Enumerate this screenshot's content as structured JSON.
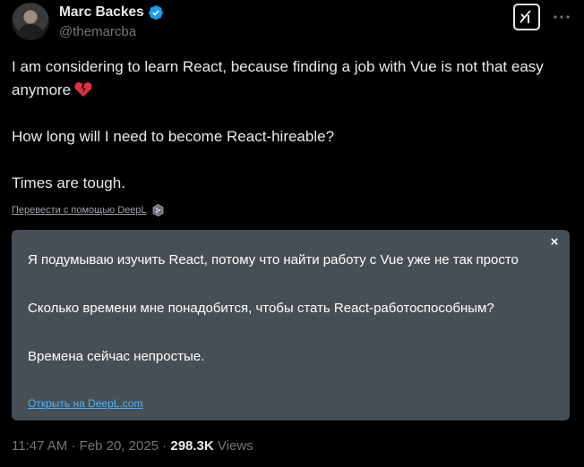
{
  "author": {
    "display_name": "Marc Backes",
    "handle": "@themarcba",
    "verified": true
  },
  "icons": {
    "verified": "verified-badge-icon",
    "grok": "grok-icon",
    "more": "more-options-icon",
    "broken_heart": "broken-heart-emoji",
    "deepl": "deepl-logo-icon",
    "close": "close-icon"
  },
  "tweet": {
    "line1": "I am considering to learn React, because finding a job with Vue is not that easy anymore",
    "line2": "How long will I need to become React-hireable?",
    "line3": "Times are tough."
  },
  "translate_link": "Перевести с помощью DeepL",
  "translation": {
    "line1": "Я подумываю изучить React, потому что найти работу с Vue уже не так просто",
    "line2": "Сколько времени мне понадобится, чтобы стать React-работоспособным?",
    "line3": "Времена сейчас непростые.",
    "close_label": "×",
    "open_link": "Открыть на DeepL.com"
  },
  "meta": {
    "time": "11:47 AM",
    "separator": "·",
    "date": "Feb 20, 2025",
    "views_count": "298.3K",
    "views_label": "Views"
  },
  "colors": {
    "background": "#000000",
    "text": "#e7e9ea",
    "muted": "#71767b",
    "verified": "#1d9bf0",
    "translation_bg": "#474f56",
    "link": "#4fb4f5"
  }
}
